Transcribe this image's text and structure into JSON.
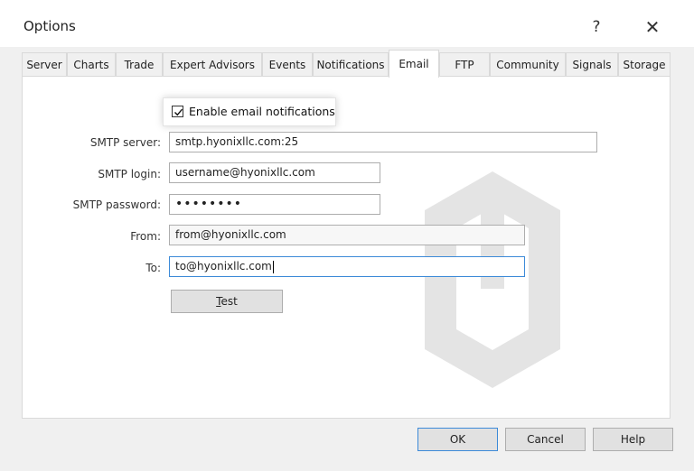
{
  "window": {
    "title": "Options",
    "help_label": "?",
    "close_label": "✕"
  },
  "tabs": [
    {
      "label": "Server"
    },
    {
      "label": "Charts"
    },
    {
      "label": "Trade"
    },
    {
      "label": "Expert Advisors"
    },
    {
      "label": "Events"
    },
    {
      "label": "Notifications"
    },
    {
      "label": "Email",
      "active": true
    },
    {
      "label": "FTP"
    },
    {
      "label": "Community"
    },
    {
      "label": "Signals"
    },
    {
      "label": "Storage"
    }
  ],
  "email": {
    "enable_label": "Enable email notifications",
    "enabled": true,
    "smtp_server": {
      "label": "SMTP server:",
      "value": "smtp.hyonixllc.com:25"
    },
    "smtp_login": {
      "label": "SMTP login:",
      "value": "username@hyonixllc.com"
    },
    "smtp_password": {
      "label": "SMTP password:",
      "value": "••••••••"
    },
    "from": {
      "label": "From:",
      "value": "from@hyonixllc.com"
    },
    "to": {
      "label": "To:",
      "value": "to@hyonixllc.com"
    },
    "test_label": "Test"
  },
  "footer": {
    "ok_label": "OK",
    "cancel_label": "Cancel",
    "help_label": "Help"
  },
  "colors": {
    "focus_border": "#3c8ad8",
    "background": "#f0f0f0"
  }
}
